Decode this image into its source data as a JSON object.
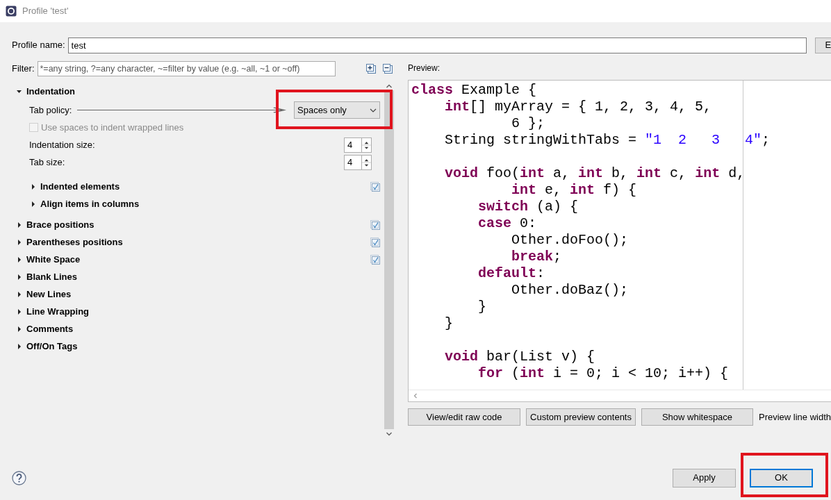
{
  "window": {
    "title": "Profile 'test'"
  },
  "profile": {
    "label": "Profile name:",
    "value": "test",
    "side_button": "E"
  },
  "filter": {
    "label": "Filter:",
    "placeholder": "*=any string, ?=any character, ~=filter by value (e.g. ~all, ~1 or ~off)"
  },
  "sections": [
    {
      "label": "Indentation",
      "expanded": true,
      "marked": false,
      "settings": [
        {
          "kind": "combo",
          "label": "Tab policy:",
          "value": "Spaces only",
          "highlighted": true
        },
        {
          "kind": "checkbox",
          "label": "Use spaces to indent wrapped lines",
          "checked": false,
          "disabled": true
        },
        {
          "kind": "spinner",
          "label": "Indentation size:",
          "value": "4"
        },
        {
          "kind": "spinner",
          "label": "Tab size:",
          "value": "4"
        }
      ],
      "children": [
        {
          "label": "Indented elements",
          "expanded": false,
          "marked": true
        },
        {
          "label": "Align items in columns",
          "expanded": false,
          "marked": false
        }
      ]
    },
    {
      "label": "Brace positions",
      "expanded": false,
      "marked": true
    },
    {
      "label": "Parentheses positions",
      "expanded": false,
      "marked": true
    },
    {
      "label": "White Space",
      "expanded": false,
      "marked": true
    },
    {
      "label": "Blank Lines",
      "expanded": false,
      "marked": false
    },
    {
      "label": "New Lines",
      "expanded": false,
      "marked": false
    },
    {
      "label": "Line Wrapping",
      "expanded": false,
      "marked": false
    },
    {
      "label": "Comments",
      "expanded": false,
      "marked": false
    },
    {
      "label": "Off/On Tags",
      "expanded": false,
      "marked": false
    }
  ],
  "preview": {
    "label": "Preview:",
    "lines": [
      {
        "parts": [
          {
            "kind": "kw",
            "text": "class"
          },
          {
            "kind": "plain",
            "text": " Example {"
          }
        ]
      },
      {
        "parts": [
          {
            "kind": "kw",
            "text": "    int"
          },
          {
            "kind": "plain",
            "text": "[] myArray = { 1, 2, 3, 4, 5,"
          }
        ]
      },
      {
        "parts": [
          {
            "kind": "plain",
            "text": "            6 };"
          }
        ]
      },
      {
        "parts": [
          {
            "kind": "plain",
            "text": "    String stringWithTabs = "
          },
          {
            "kind": "str",
            "text": "\"1  2   3   4\""
          },
          {
            "kind": "plain",
            "text": ";"
          }
        ],
        "gap_after": true
      },
      {
        "parts": [
          {
            "kind": "kw",
            "text": "    void"
          },
          {
            "kind": "plain",
            "text": " foo("
          },
          {
            "kind": "kw",
            "text": "int"
          },
          {
            "kind": "plain",
            "text": " a, "
          },
          {
            "kind": "kw",
            "text": "int"
          },
          {
            "kind": "plain",
            "text": " b, "
          },
          {
            "kind": "kw",
            "text": "int"
          },
          {
            "kind": "plain",
            "text": " c, "
          },
          {
            "kind": "kw",
            "text": "int"
          },
          {
            "kind": "plain",
            "text": " d,"
          }
        ]
      },
      {
        "parts": [
          {
            "kind": "kw",
            "text": "            int"
          },
          {
            "kind": "plain",
            "text": " e, "
          },
          {
            "kind": "kw",
            "text": "int"
          },
          {
            "kind": "plain",
            "text": " f) {"
          }
        ]
      },
      {
        "parts": [
          {
            "kind": "kw",
            "text": "        switch"
          },
          {
            "kind": "plain",
            "text": " (a) {"
          }
        ]
      },
      {
        "parts": [
          {
            "kind": "kw",
            "text": "        case"
          },
          {
            "kind": "plain",
            "text": " 0:"
          }
        ]
      },
      {
        "parts": [
          {
            "kind": "plain",
            "text": "            Other.doFoo();"
          }
        ]
      },
      {
        "parts": [
          {
            "kind": "kw",
            "text": "            break"
          },
          {
            "kind": "plain",
            "text": ";"
          }
        ]
      },
      {
        "parts": [
          {
            "kind": "kw",
            "text": "        default"
          },
          {
            "kind": "plain",
            "text": ":"
          }
        ]
      },
      {
        "parts": [
          {
            "kind": "plain",
            "text": "            Other.doBaz();"
          }
        ]
      },
      {
        "parts": [
          {
            "kind": "plain",
            "text": "        }"
          }
        ]
      },
      {
        "parts": [
          {
            "kind": "plain",
            "text": "    }"
          }
        ],
        "gap_after": true
      },
      {
        "parts": [
          {
            "kind": "kw",
            "text": "    void"
          },
          {
            "kind": "plain",
            "text": " bar(List v) {"
          }
        ]
      },
      {
        "parts": [
          {
            "kind": "kw",
            "text": "        for"
          },
          {
            "kind": "plain",
            "text": " ("
          },
          {
            "kind": "kw",
            "text": "int"
          },
          {
            "kind": "plain",
            "text": " i = 0; i < 10; i++) {"
          }
        ]
      }
    ],
    "buttons": [
      "View/edit raw code",
      "Custom preview contents",
      "Show whitespace"
    ],
    "line_width_label": "Preview line width"
  },
  "footer": {
    "buttons": [
      {
        "label": "Apply",
        "default": false,
        "highlighted": false
      },
      {
        "label": "OK",
        "default": true,
        "highlighted": true
      }
    ]
  }
}
